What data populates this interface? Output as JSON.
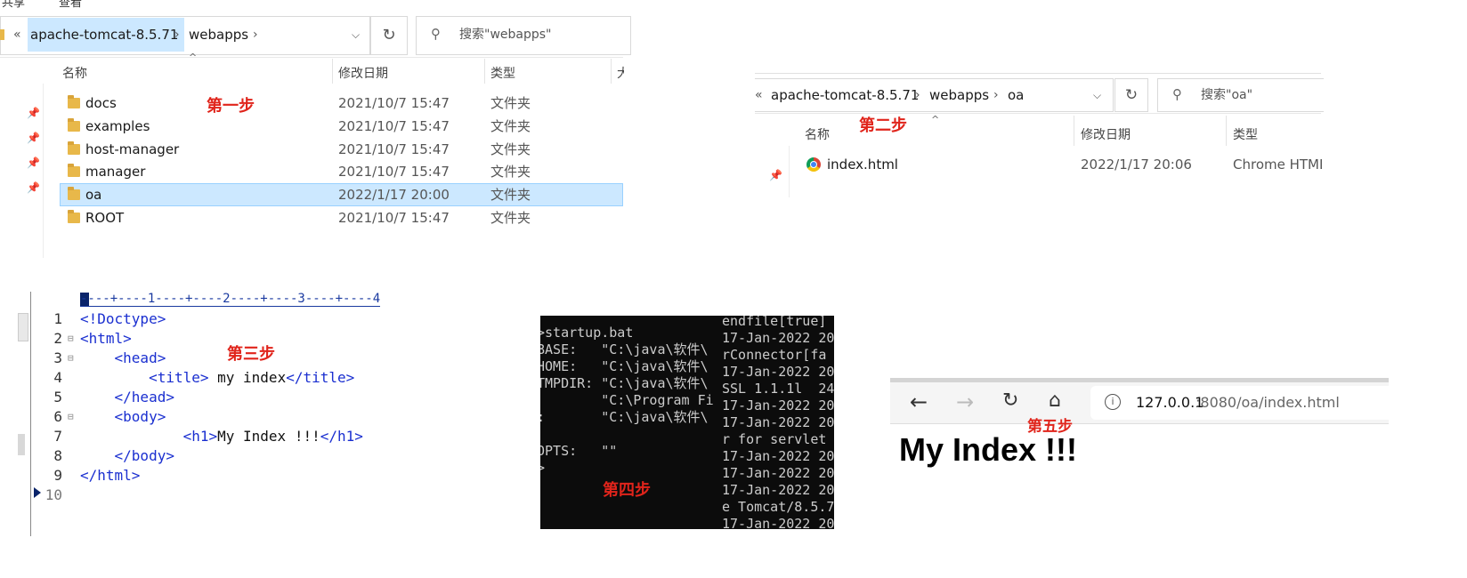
{
  "explorer1": {
    "top_menu": [
      "共享",
      "查看"
    ],
    "nav_prefix": "«",
    "breadcrumb": [
      "apache-tomcat-8.5.71",
      "webapps"
    ],
    "search_placeholder": "搜索\"webapps\"",
    "columns": {
      "name": "名称",
      "date": "修改日期",
      "type": "类型",
      "size": "大"
    },
    "rows": [
      {
        "name": "docs",
        "date": "2021/10/7 15:47",
        "type": "文件夹"
      },
      {
        "name": "examples",
        "date": "2021/10/7 15:47",
        "type": "文件夹"
      },
      {
        "name": "host-manager",
        "date": "2021/10/7 15:47",
        "type": "文件夹"
      },
      {
        "name": "manager",
        "date": "2021/10/7 15:47",
        "type": "文件夹"
      },
      {
        "name": "oa",
        "date": "2022/1/17 20:00",
        "type": "文件夹",
        "selected": true
      },
      {
        "name": "ROOT",
        "date": "2021/10/7 15:47",
        "type": "文件夹"
      }
    ],
    "step_label": "第一步"
  },
  "explorer2": {
    "nav_prefix": "«",
    "breadcrumb": [
      "apache-tomcat-8.5.71",
      "webapps",
      "oa"
    ],
    "search_placeholder": "搜索\"oa\"",
    "columns": {
      "name": "名称",
      "date": "修改日期",
      "type": "类型"
    },
    "rows": [
      {
        "name": "index.html",
        "date": "2022/1/17 20:06",
        "type": "Chrome HTML"
      }
    ],
    "step_label": "第二步"
  },
  "editor": {
    "ruler": "----+----1----+----2----+----3----+----4",
    "line_numbers": [
      "1",
      "2",
      "3",
      "4",
      "5",
      "6",
      "7",
      "8",
      "9",
      "10"
    ],
    "lines": [
      {
        "indent": "",
        "tag1": "<!Doctype>",
        "text": "",
        "tag2": ""
      },
      {
        "indent": "",
        "tag1": "<html>",
        "text": "",
        "tag2": ""
      },
      {
        "indent": "    ",
        "tag1": "<head>",
        "text": "",
        "tag2": ""
      },
      {
        "indent": "        ",
        "tag1": "<title>",
        "text": " my index",
        "tag2": "</title>"
      },
      {
        "indent": "    ",
        "tag1": "</head>",
        "text": "",
        "tag2": ""
      },
      {
        "indent": "    ",
        "tag1": "<body>",
        "text": "",
        "tag2": ""
      },
      {
        "indent": "            ",
        "tag1": "<h1>",
        "text": "My Index !!!",
        "tag2": "</h1>"
      },
      {
        "indent": "    ",
        "tag1": "</body>",
        "text": "",
        "tag2": ""
      },
      {
        "indent": "",
        "tag1": "</html>",
        "text": "",
        "tag2": ""
      },
      {
        "indent": "",
        "tag1": "",
        "text": "",
        "tag2": ""
      }
    ],
    "step_label": "第三步"
  },
  "terminal": {
    "left_lines": [
      ">startup.bat",
      "BASE:   \"C:\\java\\软件\\",
      "HOME:   \"C:\\java\\软件\\",
      "TMPDIR: \"C:\\java\\软件\\",
      "        \"C:\\Program Fi",
      ":       \"C:\\java\\软件\\",
      "",
      "OPTS:   \"\"",
      ">"
    ],
    "right_lines": [
      "endfile[true]",
      "17-Jan-2022 20",
      "rConnector[fa",
      "17-Jan-2022 20",
      "SSL 1.1.1l  24",
      "17-Jan-2022 20",
      "17-Jan-2022 20",
      "r for servlet",
      "17-Jan-2022 20",
      "17-Jan-2022 20",
      "17-Jan-2022 20",
      "e Tomcat/8.5.7",
      "17-Jan-2022 20"
    ],
    "step_label": "第四步"
  },
  "browser": {
    "url_host": "127.0.0.1",
    "url_rest": ":8080/oa/index.html",
    "page_heading": "My Index !!!",
    "step_label": "第五步"
  }
}
